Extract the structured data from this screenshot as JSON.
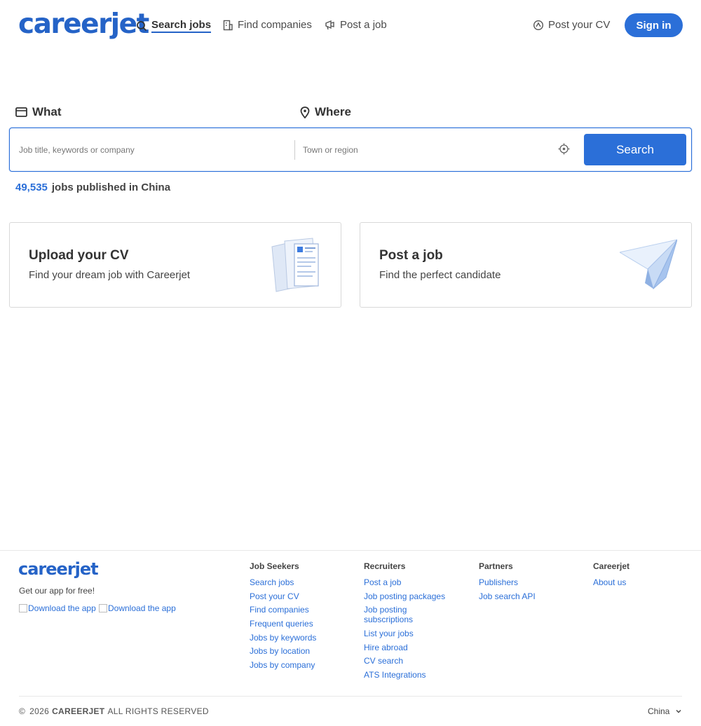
{
  "header": {
    "logo": "careerjet",
    "nav": [
      {
        "label": "Search jobs",
        "icon": "search-icon"
      },
      {
        "label": "Find companies",
        "icon": "building-icon"
      },
      {
        "label": "Post a job",
        "icon": "megaphone-icon"
      }
    ],
    "post_cv": "Post your CV",
    "sign_in": "Sign in"
  },
  "search": {
    "what_label": "What",
    "where_label": "Where",
    "what_placeholder": "Job title, keywords or company",
    "where_placeholder": "Town or region",
    "button": "Search"
  },
  "stats": {
    "count": "49,535",
    "text": "jobs published in China"
  },
  "cards": {
    "cv": {
      "title": "Upload your CV",
      "subtitle": "Find your dream job with Careerjet"
    },
    "job": {
      "title": "Post a job",
      "subtitle": "Find the perfect candidate"
    }
  },
  "footer": {
    "logo": "careerjet",
    "app_text": "Get our app for free!",
    "badge1": "Download the app",
    "badge2": "Download the app",
    "seekers": {
      "title": "Job Seekers",
      "links": [
        "Search jobs",
        "Post your CV",
        "Find companies",
        "Frequent queries",
        "Jobs by keywords",
        "Jobs by location",
        "Jobs by company"
      ]
    },
    "recruiters": {
      "title": "Recruiters",
      "links": [
        "Post a job",
        "Job posting packages",
        "Job posting subscriptions",
        "List your jobs",
        "Hire abroad",
        "CV search",
        "ATS Integrations"
      ]
    },
    "partners": {
      "title": "Partners",
      "links": [
        "Publishers",
        "Job search API"
      ]
    },
    "careerjet": {
      "title": "Careerjet",
      "links": [
        "About us"
      ]
    },
    "copyright_year": "2026",
    "copyright_brand": "CAREERJET",
    "copyright_rest": "ALL RIGHTS RESERVED",
    "country": "China"
  },
  "colors": {
    "accent": "#2b6fd8",
    "logo": "#2563c7"
  }
}
